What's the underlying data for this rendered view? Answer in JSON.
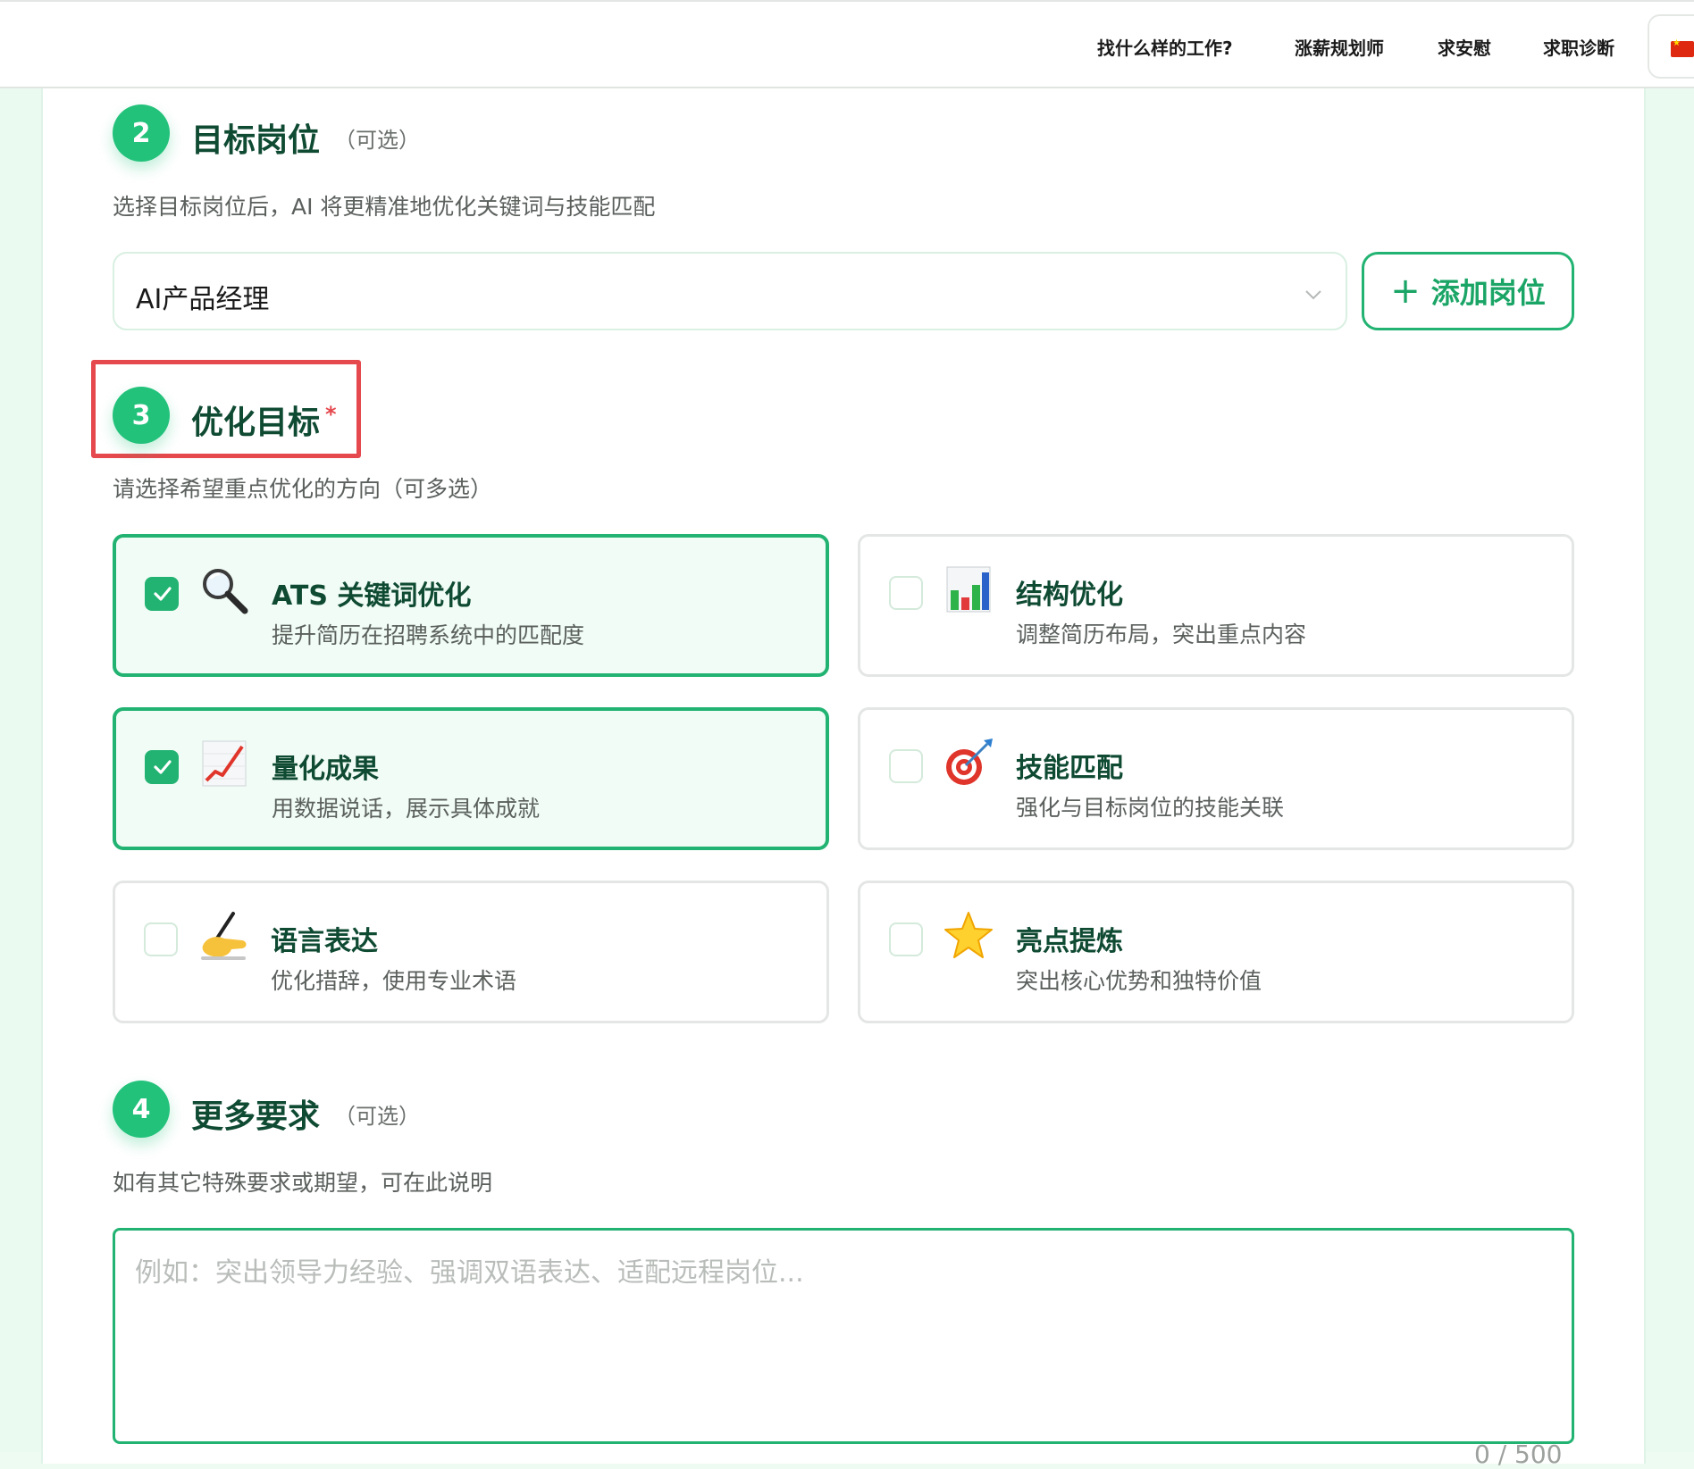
{
  "nav": {
    "items": [
      "找什么样的工作?",
      "涨薪规划师",
      "求安慰",
      "求职诊断"
    ],
    "language_icon": "china-flag-icon"
  },
  "target_job": {
    "step": "2",
    "title": "目标岗位",
    "optional": "（可选）",
    "description": "选择目标岗位后，AI 将更精准地优化关键词与技能匹配",
    "selected_value": "AI产品经理",
    "add_button_label": "添加岗位"
  },
  "optimize_goal": {
    "step": "3",
    "title": "优化目标",
    "required_mark": "*",
    "description": "请选择希望重点优化的方向（可多选）",
    "options": [
      {
        "title": "ATS 关键词优化",
        "desc": "提升简历在招聘系统中的匹配度",
        "icon": "magnifier-icon",
        "checked": true
      },
      {
        "title": "结构优化",
        "desc": "调整简历布局，突出重点内容",
        "icon": "bar-chart-icon",
        "checked": false
      },
      {
        "title": "量化成果",
        "desc": "用数据说话，展示具体成就",
        "icon": "trend-up-chart-icon",
        "checked": true
      },
      {
        "title": "技能匹配",
        "desc": "强化与目标岗位的技能关联",
        "icon": "target-dart-icon",
        "checked": false
      },
      {
        "title": "语言表达",
        "desc": "优化措辞，使用专业术语",
        "icon": "writing-hand-icon",
        "checked": false
      },
      {
        "title": "亮点提炼",
        "desc": "突出核心优势和独特价值",
        "icon": "star-icon",
        "checked": false
      }
    ]
  },
  "more_requirements": {
    "step": "4",
    "title": "更多要求",
    "optional": "（可选）",
    "description": "如有其它特殊要求或期望，可在此说明",
    "placeholder": "例如：突出领导力经验、强调双语表达、适配远程岗位...",
    "value": "",
    "counter": "0 / 500"
  },
  "colors": {
    "accent": "#22b372",
    "step_circle": "#22c27b",
    "title": "#0f4a33",
    "highlight": "#e5484d"
  }
}
